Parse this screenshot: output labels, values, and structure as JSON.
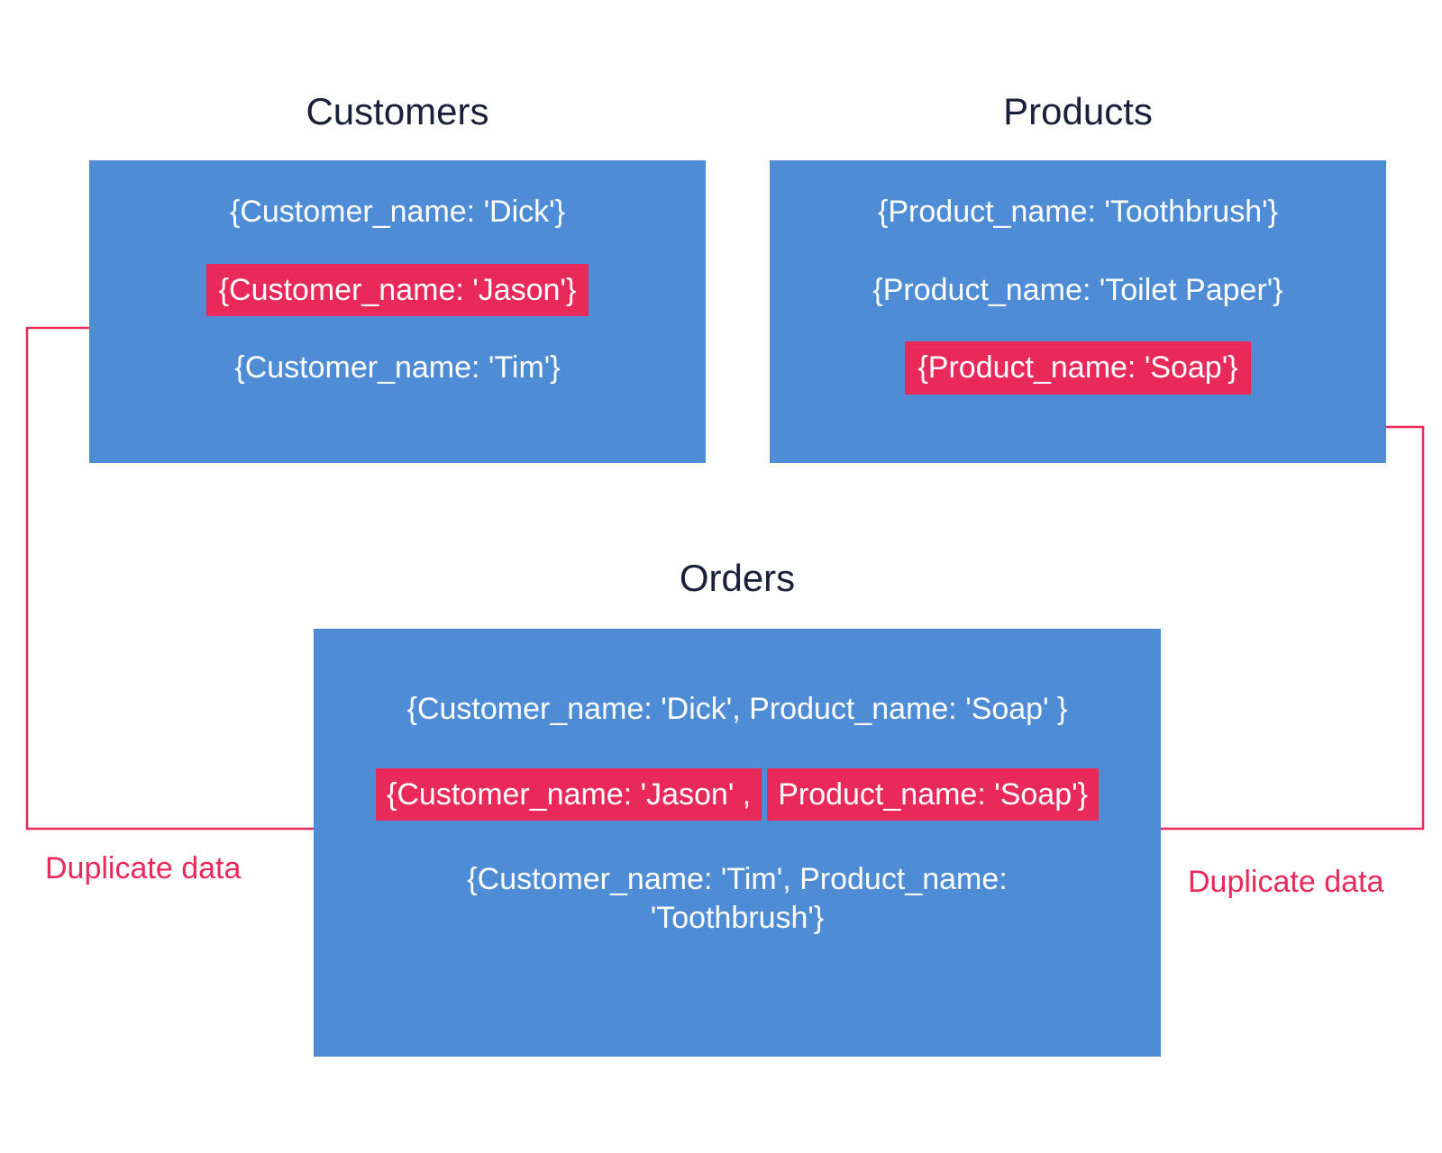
{
  "colors": {
    "box_bg": "#4f8cd6",
    "highlight_bg": "#e92959",
    "title_text": "#1a1f3a",
    "row_text": "#ffffff"
  },
  "customers": {
    "title": "Customers",
    "rows": [
      "{Customer_name: 'Dick'}",
      "{Customer_name: 'Jason'}",
      "{Customer_name: 'Tim'}"
    ],
    "highlight_index": 1
  },
  "products": {
    "title": "Products",
    "rows": [
      "{Product_name: 'Toothbrush'}",
      "{Product_name: 'Toilet Paper'}",
      "{Product_name: 'Soap'}"
    ],
    "highlight_index": 2
  },
  "orders": {
    "title": "Orders",
    "rows": [
      {
        "full": "{Customer_name: 'Dick', Product_name: 'Soap' }",
        "highlight_left": false,
        "highlight_right": false
      },
      {
        "left": "{Customer_name: 'Jason' ,",
        "right": " Product_name: 'Soap'}",
        "highlight_left": true,
        "highlight_right": true
      },
      {
        "full": "{Customer_name: 'Tim', Product_name: 'Toothbrush'}",
        "highlight_left": false,
        "highlight_right": false
      }
    ]
  },
  "labels": {
    "duplicate_left": "Duplicate data",
    "duplicate_right": "Duplicate data"
  }
}
